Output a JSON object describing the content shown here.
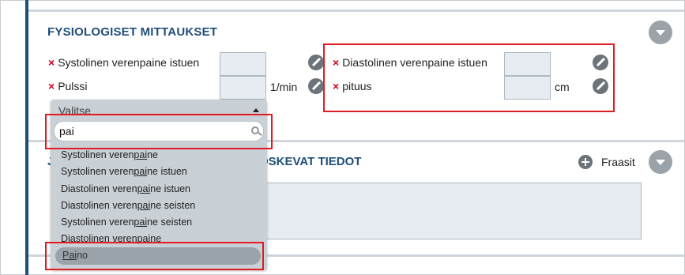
{
  "physio": {
    "title": "FYSIOLOGISET MITTAUKSET",
    "required_mark": "×",
    "systolic_label": "Systolinen verenpaine istuen",
    "pulse_label": "Pulssi",
    "pulse_unit": "1/min",
    "diastolic_label": "Diastolinen verenpaine istuen",
    "height_label": "pituus",
    "height_unit": "cm"
  },
  "dropdown": {
    "header": "Valitse",
    "search_value": "pai",
    "items": [
      {
        "pre": "Systolinen veren",
        "hl": "pai",
        "post": "ne"
      },
      {
        "pre": "Systolinen veren",
        "hl": "pai",
        "post": "ne istuen"
      },
      {
        "pre": "Diastolinen veren",
        "hl": "pai",
        "post": "ne istuen"
      },
      {
        "pre": "Diastolinen veren",
        "hl": "pai",
        "post": "ne seisten"
      },
      {
        "pre": "Systolinen veren",
        "hl": "pai",
        "post": "ne seisten"
      },
      {
        "pre": "Diastolinen veren",
        "hl": "pai",
        "post": "ne"
      }
    ],
    "selected": {
      "pre": "",
      "hl": "Pai",
      "post": "no"
    }
  },
  "section2": {
    "title_visible_start": "J",
    "title_visible_end": "OSKEVAT TIEDOT",
    "phrases_label": "Fraasit"
  },
  "colors": {
    "accent": "#1f4e79",
    "highlight_box": "#e01b24",
    "input_bg": "#e6ecf1"
  }
}
